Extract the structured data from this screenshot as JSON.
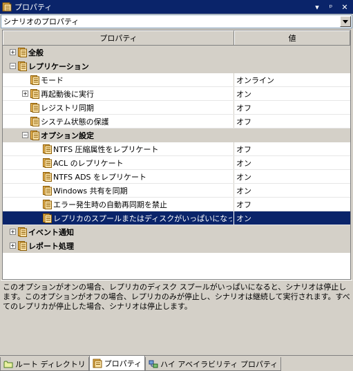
{
  "window": {
    "title": "プロパティ",
    "controls": [
      "▾",
      "ᵖ",
      "✕"
    ]
  },
  "scenario_combo": {
    "value": "シナリオのプロパティ"
  },
  "grid": {
    "col_property": "プロパティ",
    "col_value": "値",
    "rows": [
      {
        "label": "全般",
        "value": "",
        "level": 0,
        "kind": "group",
        "expander": "+"
      },
      {
        "label": "レプリケーション",
        "value": "",
        "level": 0,
        "kind": "group",
        "expander": "−"
      },
      {
        "label": "モード",
        "value": "オンライン",
        "level": 1,
        "kind": "item",
        "expander": ""
      },
      {
        "label": "再起動後に実行",
        "value": "オン",
        "level": 1,
        "kind": "item",
        "expander": "+"
      },
      {
        "label": "レジストリ同期",
        "value": "オフ",
        "level": 1,
        "kind": "item",
        "expander": ""
      },
      {
        "label": "システム状態の保護",
        "value": "オフ",
        "level": 1,
        "kind": "item",
        "expander": ""
      },
      {
        "label": "オプション設定",
        "value": "",
        "level": 1,
        "kind": "group",
        "expander": "−"
      },
      {
        "label": "NTFS 圧縮属性をレプリケート",
        "value": "オフ",
        "level": 2,
        "kind": "item",
        "expander": ""
      },
      {
        "label": "ACL のレプリケート",
        "value": "オン",
        "level": 2,
        "kind": "item",
        "expander": ""
      },
      {
        "label": "NTFS ADS をレプリケート",
        "value": "オン",
        "level": 2,
        "kind": "item",
        "expander": ""
      },
      {
        "label": "Windows 共有を同期",
        "value": "オン",
        "level": 2,
        "kind": "item",
        "expander": ""
      },
      {
        "label": "エラー発生時の自動再同期を禁止",
        "value": "オフ",
        "level": 2,
        "kind": "item",
        "expander": ""
      },
      {
        "label": "レプリカのスプールまたはディスクがいっぱいになったらシ...",
        "value": "オン",
        "level": 2,
        "kind": "selected",
        "expander": ""
      },
      {
        "label": "イベント通知",
        "value": "",
        "level": 0,
        "kind": "group",
        "expander": "+"
      },
      {
        "label": "レポート処理",
        "value": "",
        "level": 0,
        "kind": "group",
        "expander": "+"
      }
    ]
  },
  "description": "このオプションがオンの場合、レプリカのディスク スプールがいっぱいになると、シナリオは停止します。このオプションがオフの場合、レプリカのみが停止し、シナリオは継続して実行されます。すべてのレプリカが停止した場合、シナリオは停止します。",
  "tabs": [
    {
      "label": "ルート ディレクトリ",
      "icon": "folder-icon",
      "active": false
    },
    {
      "label": "プロパティ",
      "icon": "properties-icon",
      "active": true
    },
    {
      "label": "ハイ アベイラビリティ プロパティ",
      "icon": "ha-properties-icon",
      "active": false
    }
  ],
  "colors": {
    "titlebar": "#0a246a",
    "selection": "#0a246a",
    "chrome": "#d4d0c8",
    "property_icon": "#f0a020"
  }
}
